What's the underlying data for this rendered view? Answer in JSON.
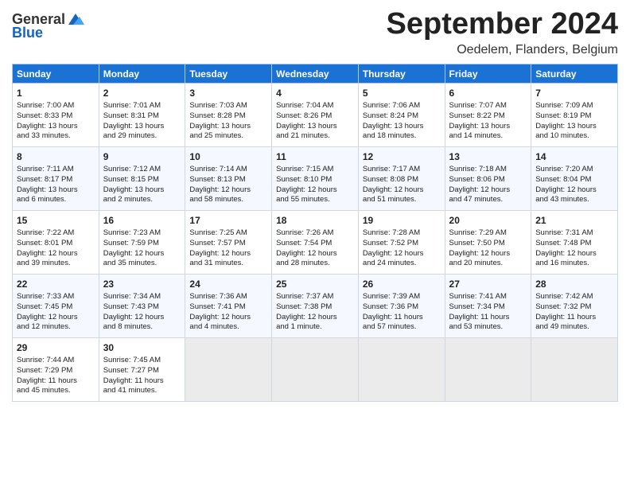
{
  "header": {
    "logo_line1": "General",
    "logo_line2": "Blue",
    "month": "September 2024",
    "location": "Oedelem, Flanders, Belgium"
  },
  "days_of_week": [
    "Sunday",
    "Monday",
    "Tuesday",
    "Wednesday",
    "Thursday",
    "Friday",
    "Saturday"
  ],
  "weeks": [
    [
      {
        "day": "1",
        "lines": [
          "Sunrise: 7:00 AM",
          "Sunset: 8:33 PM",
          "Daylight: 13 hours",
          "and 33 minutes."
        ]
      },
      {
        "day": "2",
        "lines": [
          "Sunrise: 7:01 AM",
          "Sunset: 8:31 PM",
          "Daylight: 13 hours",
          "and 29 minutes."
        ]
      },
      {
        "day": "3",
        "lines": [
          "Sunrise: 7:03 AM",
          "Sunset: 8:28 PM",
          "Daylight: 13 hours",
          "and 25 minutes."
        ]
      },
      {
        "day": "4",
        "lines": [
          "Sunrise: 7:04 AM",
          "Sunset: 8:26 PM",
          "Daylight: 13 hours",
          "and 21 minutes."
        ]
      },
      {
        "day": "5",
        "lines": [
          "Sunrise: 7:06 AM",
          "Sunset: 8:24 PM",
          "Daylight: 13 hours",
          "and 18 minutes."
        ]
      },
      {
        "day": "6",
        "lines": [
          "Sunrise: 7:07 AM",
          "Sunset: 8:22 PM",
          "Daylight: 13 hours",
          "and 14 minutes."
        ]
      },
      {
        "day": "7",
        "lines": [
          "Sunrise: 7:09 AM",
          "Sunset: 8:19 PM",
          "Daylight: 13 hours",
          "and 10 minutes."
        ]
      }
    ],
    [
      {
        "day": "8",
        "lines": [
          "Sunrise: 7:11 AM",
          "Sunset: 8:17 PM",
          "Daylight: 13 hours",
          "and 6 minutes."
        ]
      },
      {
        "day": "9",
        "lines": [
          "Sunrise: 7:12 AM",
          "Sunset: 8:15 PM",
          "Daylight: 13 hours",
          "and 2 minutes."
        ]
      },
      {
        "day": "10",
        "lines": [
          "Sunrise: 7:14 AM",
          "Sunset: 8:13 PM",
          "Daylight: 12 hours",
          "and 58 minutes."
        ]
      },
      {
        "day": "11",
        "lines": [
          "Sunrise: 7:15 AM",
          "Sunset: 8:10 PM",
          "Daylight: 12 hours",
          "and 55 minutes."
        ]
      },
      {
        "day": "12",
        "lines": [
          "Sunrise: 7:17 AM",
          "Sunset: 8:08 PM",
          "Daylight: 12 hours",
          "and 51 minutes."
        ]
      },
      {
        "day": "13",
        "lines": [
          "Sunrise: 7:18 AM",
          "Sunset: 8:06 PM",
          "Daylight: 12 hours",
          "and 47 minutes."
        ]
      },
      {
        "day": "14",
        "lines": [
          "Sunrise: 7:20 AM",
          "Sunset: 8:04 PM",
          "Daylight: 12 hours",
          "and 43 minutes."
        ]
      }
    ],
    [
      {
        "day": "15",
        "lines": [
          "Sunrise: 7:22 AM",
          "Sunset: 8:01 PM",
          "Daylight: 12 hours",
          "and 39 minutes."
        ]
      },
      {
        "day": "16",
        "lines": [
          "Sunrise: 7:23 AM",
          "Sunset: 7:59 PM",
          "Daylight: 12 hours",
          "and 35 minutes."
        ]
      },
      {
        "day": "17",
        "lines": [
          "Sunrise: 7:25 AM",
          "Sunset: 7:57 PM",
          "Daylight: 12 hours",
          "and 31 minutes."
        ]
      },
      {
        "day": "18",
        "lines": [
          "Sunrise: 7:26 AM",
          "Sunset: 7:54 PM",
          "Daylight: 12 hours",
          "and 28 minutes."
        ]
      },
      {
        "day": "19",
        "lines": [
          "Sunrise: 7:28 AM",
          "Sunset: 7:52 PM",
          "Daylight: 12 hours",
          "and 24 minutes."
        ]
      },
      {
        "day": "20",
        "lines": [
          "Sunrise: 7:29 AM",
          "Sunset: 7:50 PM",
          "Daylight: 12 hours",
          "and 20 minutes."
        ]
      },
      {
        "day": "21",
        "lines": [
          "Sunrise: 7:31 AM",
          "Sunset: 7:48 PM",
          "Daylight: 12 hours",
          "and 16 minutes."
        ]
      }
    ],
    [
      {
        "day": "22",
        "lines": [
          "Sunrise: 7:33 AM",
          "Sunset: 7:45 PM",
          "Daylight: 12 hours",
          "and 12 minutes."
        ]
      },
      {
        "day": "23",
        "lines": [
          "Sunrise: 7:34 AM",
          "Sunset: 7:43 PM",
          "Daylight: 12 hours",
          "and 8 minutes."
        ]
      },
      {
        "day": "24",
        "lines": [
          "Sunrise: 7:36 AM",
          "Sunset: 7:41 PM",
          "Daylight: 12 hours",
          "and 4 minutes."
        ]
      },
      {
        "day": "25",
        "lines": [
          "Sunrise: 7:37 AM",
          "Sunset: 7:38 PM",
          "Daylight: 12 hours",
          "and 1 minute."
        ]
      },
      {
        "day": "26",
        "lines": [
          "Sunrise: 7:39 AM",
          "Sunset: 7:36 PM",
          "Daylight: 11 hours",
          "and 57 minutes."
        ]
      },
      {
        "day": "27",
        "lines": [
          "Sunrise: 7:41 AM",
          "Sunset: 7:34 PM",
          "Daylight: 11 hours",
          "and 53 minutes."
        ]
      },
      {
        "day": "28",
        "lines": [
          "Sunrise: 7:42 AM",
          "Sunset: 7:32 PM",
          "Daylight: 11 hours",
          "and 49 minutes."
        ]
      }
    ],
    [
      {
        "day": "29",
        "lines": [
          "Sunrise: 7:44 AM",
          "Sunset: 7:29 PM",
          "Daylight: 11 hours",
          "and 45 minutes."
        ]
      },
      {
        "day": "30",
        "lines": [
          "Sunrise: 7:45 AM",
          "Sunset: 7:27 PM",
          "Daylight: 11 hours",
          "and 41 minutes."
        ]
      },
      {
        "day": "",
        "lines": []
      },
      {
        "day": "",
        "lines": []
      },
      {
        "day": "",
        "lines": []
      },
      {
        "day": "",
        "lines": []
      },
      {
        "day": "",
        "lines": []
      }
    ]
  ]
}
